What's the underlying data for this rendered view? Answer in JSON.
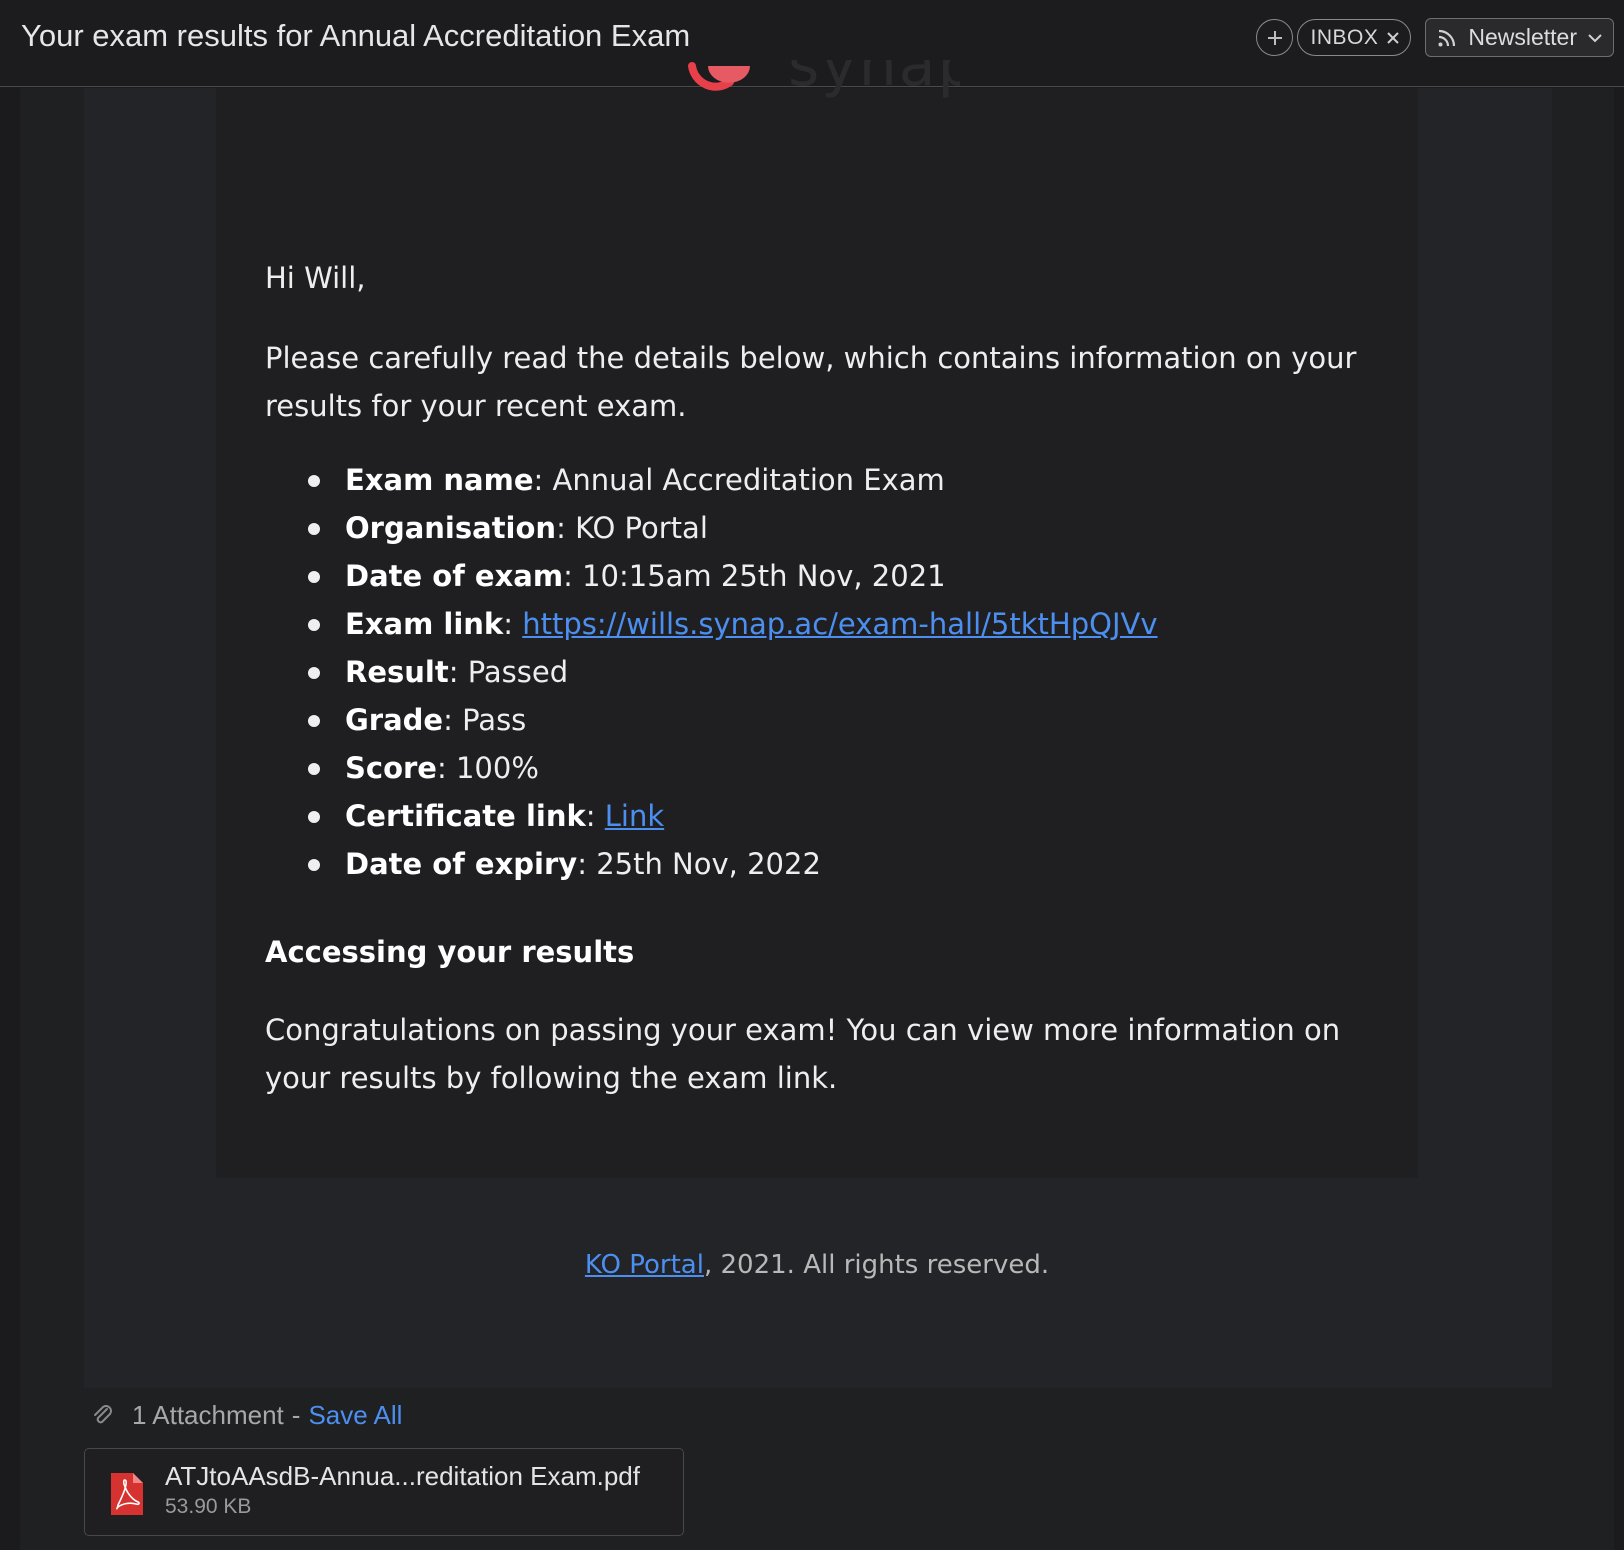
{
  "header": {
    "subject": "Your exam results for Annual Accreditation Exam",
    "add_icon": "plus-circle-icon",
    "label_tag": "INBOX",
    "newsletter_label": "Newsletter"
  },
  "email": {
    "greeting": "Hi Will,",
    "intro": "Please carefully read the details below, which contains information on your results for your recent exam.",
    "details": [
      {
        "label": "Exam name",
        "value": "Annual Accreditation Exam"
      },
      {
        "label": "Organisation",
        "value": "KO Portal"
      },
      {
        "label": "Date of exam",
        "value": "10:15am 25th Nov, 2021"
      },
      {
        "label": "Exam link",
        "link": "https://wills.synap.ac/exam-hall/5tktHpQJVv"
      },
      {
        "label": "Result",
        "value": "Passed"
      },
      {
        "label": "Grade",
        "value": "Pass"
      },
      {
        "label": "Score",
        "value": "100%"
      },
      {
        "label": "Certificate link",
        "link": "Link"
      },
      {
        "label": "Date of expiry",
        "value": "25th Nov, 2022"
      }
    ],
    "section_title": "Accessing your results",
    "congrats": "Congratulations on passing your exam! You can view more information on your results by following the exam link.",
    "footer_link": "KO Portal",
    "footer_text": ", 2021. All rights reserved."
  },
  "attachments": {
    "count_label": "1 Attachment",
    "separator": "-",
    "save_all": "Save All",
    "file": {
      "name": "ATJtoAAsdB-Annua...reditation Exam.pdf",
      "size": "53.90 KB"
    }
  },
  "colors": {
    "link": "#4c8ff0",
    "logo_accent": "#e8404a",
    "pdf_red": "#d6322f"
  }
}
